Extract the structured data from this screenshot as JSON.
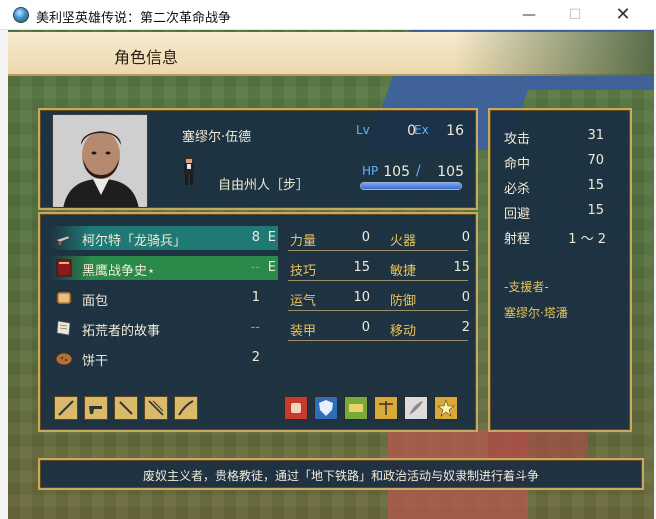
{
  "window": {
    "title": "美利坚英雄传说：第二次革命战争",
    "minimize": "—",
    "maximize": "☐",
    "close": "✕"
  },
  "screen": {
    "header": "角色信息"
  },
  "character": {
    "name": "塞缪尔·伍德",
    "class": "自由州人［步］",
    "lv_label": "Lv",
    "lv": "0",
    "ex_label": "Ex",
    "ex": "16",
    "hp_label": "HP",
    "hp": "105",
    "hp_sep": "/",
    "hp_max": "105",
    "hp_fraction": 1.0
  },
  "inventory": [
    {
      "name": "柯尔特「龙骑兵」",
      "uses": "8",
      "equip": "E",
      "icon": "revolver-icon",
      "highlight": "teal"
    },
    {
      "name": "黑鹰战争史⋆",
      "uses": "--",
      "equip": "E",
      "icon": "book-icon",
      "highlight": "green"
    },
    {
      "name": "面包",
      "uses": "1",
      "equip": "",
      "icon": "bread-icon",
      "highlight": ""
    },
    {
      "name": "拓荒者的故事",
      "uses": "--",
      "equip": "",
      "icon": "scroll-icon",
      "highlight": ""
    },
    {
      "name": "饼干",
      "uses": "2",
      "equip": "",
      "icon": "biscuit-icon",
      "highlight": ""
    }
  ],
  "stats": [
    {
      "label": "力量",
      "value": "0"
    },
    {
      "label": "火器",
      "value": "0"
    },
    {
      "label": "技巧",
      "value": "15"
    },
    {
      "label": "敏捷",
      "value": "15"
    },
    {
      "label": "运气",
      "value": "10"
    },
    {
      "label": "防御",
      "value": "0"
    },
    {
      "label": "装甲",
      "value": "0"
    },
    {
      "label": "移动",
      "value": "2"
    }
  ],
  "combat": [
    {
      "label": "攻击",
      "value": "31"
    },
    {
      "label": "命中",
      "value": "70"
    },
    {
      "label": "必杀",
      "value": "15"
    },
    {
      "label": "回避",
      "value": "15"
    }
  ],
  "range": {
    "label": "射程",
    "value": "1 ～ 2"
  },
  "support": {
    "title": "-支援者-",
    "name": "塞缪尔·塔潘"
  },
  "weapon_ranks": [
    "sword-icon",
    "pistol-icon",
    "knife-icon",
    "bayonet-icon",
    "saber-icon"
  ],
  "skills": [
    "fist-icon",
    "shield-icon",
    "cash-icon",
    "scales-icon",
    "quill-icon",
    "star-icon"
  ],
  "description": "废奴主义者，贵格教徒，通过「地下铁路」和政治活动与奴隶制进行着斗争",
  "colors": {
    "panel": "#1a2e42",
    "border": "#c9a85f",
    "label_gold": "#e7c35a",
    "label_blue": "#5fb3ff",
    "text": "#f0ead8"
  }
}
